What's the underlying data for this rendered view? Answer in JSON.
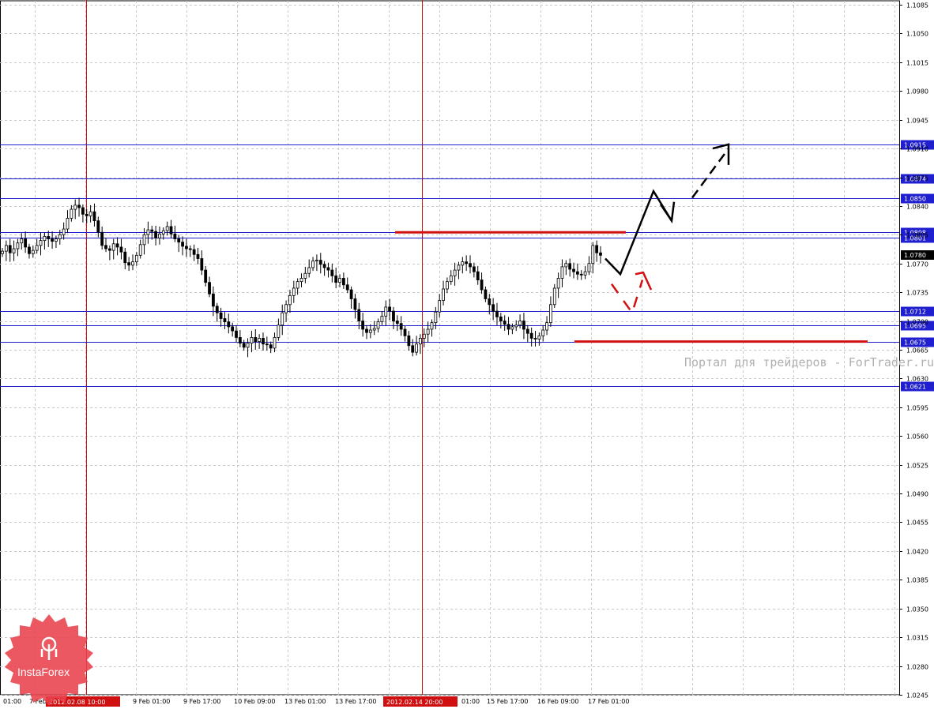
{
  "chart_data": {
    "type": "candlestick",
    "title": "",
    "y_range": [
      1.0245,
      1.1085
    ],
    "y_ticks": [
      "1.1085",
      "1.1050",
      "1.1015",
      "1.0980",
      "1.0945",
      "1.0910",
      "1.0875",
      "1.0840",
      "1.0805",
      "1.0770",
      "1.0735",
      "1.0700",
      "1.0665",
      "1.0630",
      "1.0595",
      "1.0560",
      "1.0525",
      "1.0490",
      "1.0455",
      "1.0420",
      "1.0385",
      "1.0350",
      "1.0315",
      "1.0280",
      "1.0245"
    ],
    "current_price": "1.0780",
    "x_labels": [
      "01:00",
      "7 Feb",
      "9 Feb 01:00",
      "9 Feb 17:00",
      "10 Feb 09:00",
      "13 Feb 01:00",
      "13 Feb 17:00",
      "01:00",
      "15 Feb 17:00",
      "16 Feb 09:00",
      "17 Feb 01:00"
    ],
    "highlighted_dates": [
      "2012.02.08 10:00",
      "2012.02.14 20:00"
    ],
    "levels": [
      {
        "value": 1.0915,
        "label": "1.0915"
      },
      {
        "value": 1.0874,
        "label": "1.0874"
      },
      {
        "value": 1.085,
        "label": "1.0850"
      },
      {
        "value": 1.0808,
        "label": "1.0808"
      },
      {
        "value": 1.0801,
        "label": "1.0801"
      },
      {
        "value": 1.0712,
        "label": "1.0712"
      },
      {
        "value": 1.0695,
        "label": "1.0695"
      },
      {
        "value": 1.0675,
        "label": "1.0675"
      },
      {
        "value": 1.0621,
        "label": "1.0621"
      }
    ],
    "red_levels": [
      1.0808,
      1.0675
    ],
    "close_series": [
      1.0785,
      1.0792,
      1.0783,
      1.0788,
      1.0795,
      1.08,
      1.079,
      1.0782,
      1.0786,
      1.0792,
      1.0798,
      1.0803,
      1.08,
      1.0797,
      1.08,
      1.0805,
      1.0812,
      1.0825,
      1.0836,
      1.0841,
      1.0838,
      1.083,
      1.0828,
      1.0833,
      1.0822,
      1.0808,
      1.0792,
      1.0788,
      1.0786,
      1.0794,
      1.079,
      1.0784,
      1.0771,
      1.0768,
      1.0772,
      1.078,
      1.0793,
      1.0805,
      1.0811,
      1.0809,
      1.0801,
      1.0806,
      1.081,
      1.0815,
      1.0806,
      1.08,
      1.0796,
      1.0791,
      1.0788,
      1.0787,
      1.0781,
      1.0776,
      1.0762,
      1.0747,
      1.0733,
      1.0718,
      1.071,
      1.0703,
      1.0699,
      1.0693,
      1.0688,
      1.068,
      1.0673,
      1.0668,
      1.0673,
      1.068,
      1.0675,
      1.0679,
      1.0672,
      1.0671,
      1.0667,
      1.068,
      1.0695,
      1.071,
      1.072,
      1.0731,
      1.074,
      1.0748,
      1.0752,
      1.0758,
      1.0765,
      1.0773,
      1.0774,
      1.0769,
      1.0765,
      1.0762,
      1.0755,
      1.0747,
      1.0752,
      1.0744,
      1.0738,
      1.0727,
      1.0714,
      1.07,
      1.069,
      1.0686,
      1.0689,
      1.0691,
      1.0699,
      1.0706,
      1.0717,
      1.0712,
      1.07,
      1.0697,
      1.069,
      1.0682,
      1.067,
      1.0662,
      1.0672,
      1.0679,
      1.0684,
      1.069,
      1.0698,
      1.0711,
      1.0725,
      1.0739,
      1.0748,
      1.0755,
      1.0762,
      1.0768,
      1.0772,
      1.077,
      1.0766,
      1.076,
      1.075,
      1.0738,
      1.0727,
      1.072,
      1.0712,
      1.0705,
      1.07,
      1.0696,
      1.069,
      1.0693,
      1.0695,
      1.07,
      1.069,
      1.0685,
      1.0679,
      1.0678,
      1.0682,
      1.0689,
      1.0698,
      1.072,
      1.074,
      1.0752,
      1.0766,
      1.077,
      1.0763,
      1.076,
      1.0757,
      1.0756,
      1.076,
      1.077,
      1.0792,
      1.0783,
      1.078
    ],
    "forecast_black": [
      [
        1.0776,
        0
      ],
      [
        1.0757,
        1
      ],
      [
        1.0858,
        2
      ],
      [
        1.0822,
        3
      ]
    ],
    "forecast_black_dashed": [
      [
        1.085,
        0
      ],
      [
        1.091,
        1
      ]
    ],
    "forecast_red_dashed": [
      [
        1.0745,
        0
      ],
      [
        1.071,
        1
      ],
      [
        1.075,
        2
      ]
    ]
  },
  "watermark": "Портал для трейдеров - ForTrader.ru",
  "logo": {
    "text": "InstaForex",
    "color": "#e8414c"
  },
  "colors": {
    "grid": "#c8c8c8",
    "level": "#1f1fd0",
    "red": "#d01010",
    "price_label_bg": "#000000",
    "date_hl_bg": "#d01010"
  }
}
